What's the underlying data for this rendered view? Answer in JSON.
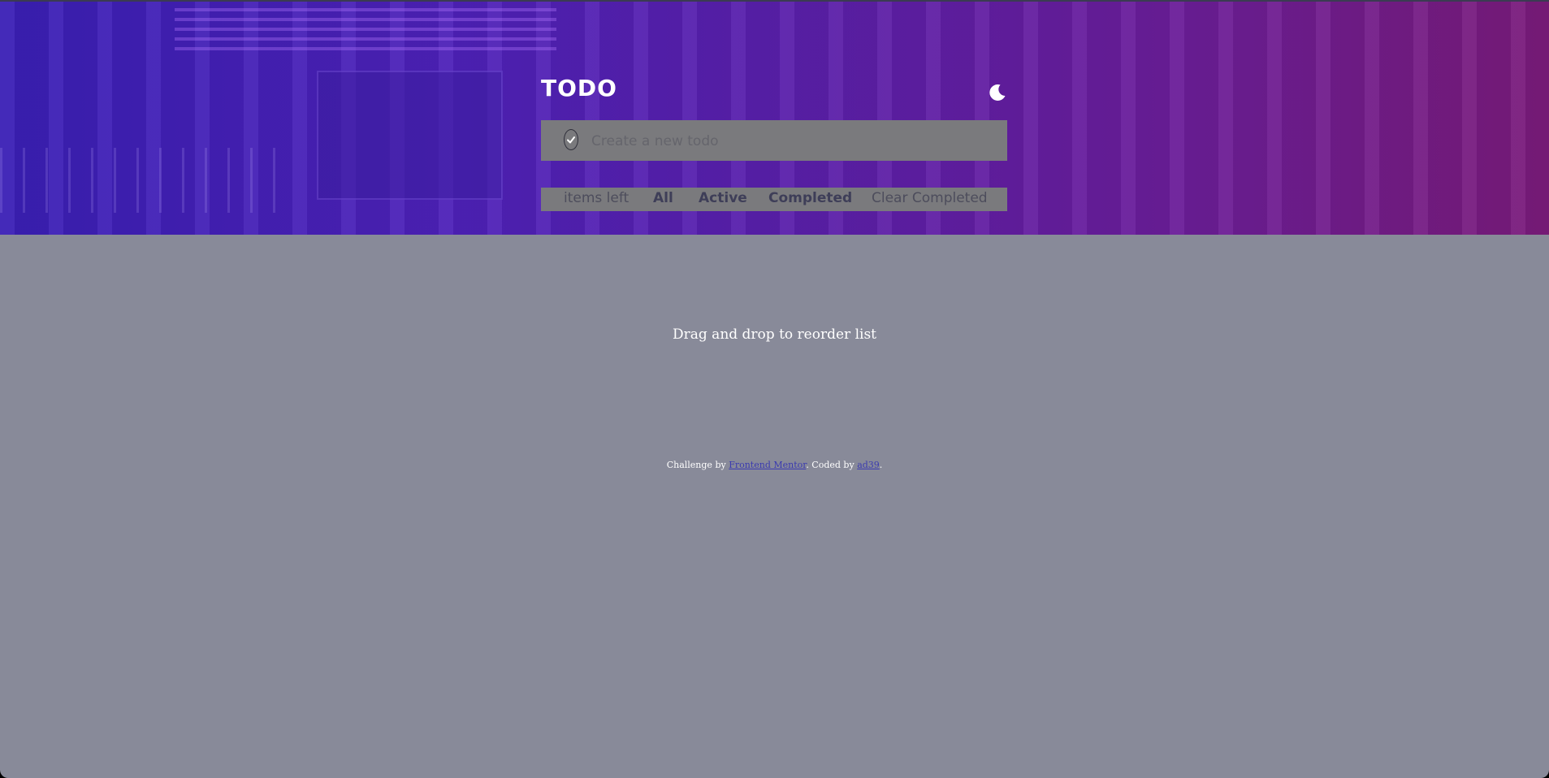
{
  "header": {
    "title": "TODO",
    "theme_icon": "moon-icon"
  },
  "new_todo": {
    "placeholder": "Create a new todo",
    "check_icon": "checkmark-icon"
  },
  "filters": {
    "items_left": "items left",
    "all": "All",
    "active": "Active",
    "completed": "Completed",
    "clear_completed": "Clear Completed"
  },
  "hint": "Drag and drop to reorder list",
  "attribution": {
    "prefix": "Challenge by ",
    "frontend_mentor": "Frontend Mentor",
    "middle": ". Coded by ",
    "author": "ad39",
    "suffix": "."
  },
  "colors": {
    "hero_start": "#3a1fb5",
    "hero_end": "#7a1b7a",
    "background": "#888a99",
    "panel": "#7a7a7d"
  }
}
